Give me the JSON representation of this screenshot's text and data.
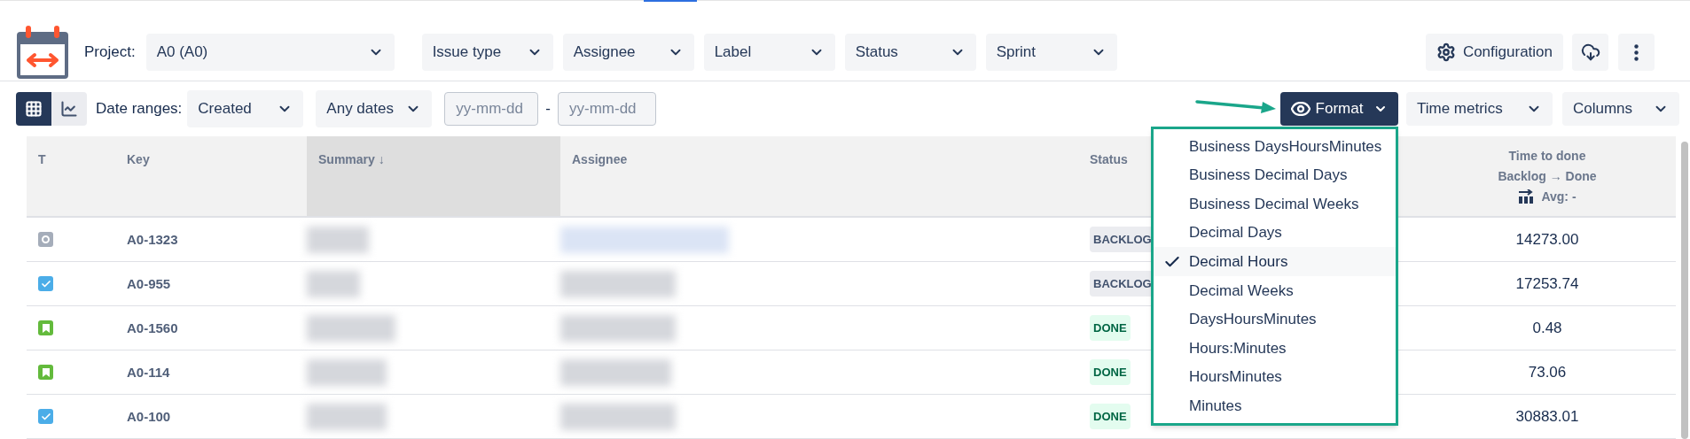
{
  "toolbar": {
    "project_label": "Project:",
    "filters": [
      {
        "label": "A0 (A0)",
        "kind": "wide"
      },
      {
        "label": "Issue type",
        "kind": "normal"
      },
      {
        "label": "Assignee",
        "kind": "normal"
      },
      {
        "label": "Label",
        "kind": "normal"
      },
      {
        "label": "Status",
        "kind": "normal"
      },
      {
        "label": "Sprint",
        "kind": "normal"
      }
    ],
    "configuration": "Configuration"
  },
  "subbar": {
    "views": [
      {
        "kind": "grid",
        "selected": true
      },
      {
        "kind": "chart",
        "selected": false
      }
    ],
    "date_ranges_label": "Date ranges:",
    "date_field": "Created",
    "date_preset": "Any dates",
    "from_placeholder": "yy-mm-dd",
    "separator": "-",
    "to_placeholder": "yy-mm-dd",
    "format": "Format",
    "time_metrics": "Time metrics",
    "columns": "Columns"
  },
  "format_menu": [
    {
      "label": "Business DaysHoursMinutes",
      "selected": false
    },
    {
      "label": "Business Decimal Days",
      "selected": false
    },
    {
      "label": "Business Decimal Weeks",
      "selected": false
    },
    {
      "label": "Decimal Days",
      "selected": false
    },
    {
      "label": "Decimal Hours",
      "selected": true
    },
    {
      "label": "Decimal Weeks",
      "selected": false
    },
    {
      "label": "DaysHoursMinutes",
      "selected": false
    },
    {
      "label": "Hours:Minutes",
      "selected": false
    },
    {
      "label": "HoursMinutes",
      "selected": false
    },
    {
      "label": "Minutes",
      "selected": false
    }
  ],
  "table": {
    "columns": [
      {
        "label": "T",
        "selected": false
      },
      {
        "label": "Key",
        "selected": false
      },
      {
        "label": "Summary ↓",
        "selected": true
      },
      {
        "label": "Assignee",
        "selected": false
      },
      {
        "label": "Status",
        "selected": false
      }
    ],
    "metric_column": {
      "title": "Time to done",
      "transition": "Backlog → Done",
      "average": "Avg: -"
    },
    "rows": [
      {
        "kind": "other",
        "key": "A0-1323",
        "status": {
          "label": "BACKLOG",
          "kind": "todo"
        },
        "time": "14273.00"
      },
      {
        "kind": "task",
        "key": "A0-955",
        "status": {
          "label": "BACKLOG",
          "kind": "todo"
        },
        "time": "17253.74"
      },
      {
        "kind": "story",
        "key": "A0-1560",
        "status": {
          "label": "DONE",
          "kind": "done"
        },
        "time": "0.48"
      },
      {
        "kind": "story",
        "key": "A0-114",
        "status": {
          "label": "DONE",
          "kind": "done"
        },
        "time": "73.06"
      },
      {
        "kind": "task",
        "key": "A0-100",
        "status": {
          "label": "DONE",
          "kind": "done"
        },
        "time": "30883.01"
      }
    ]
  }
}
